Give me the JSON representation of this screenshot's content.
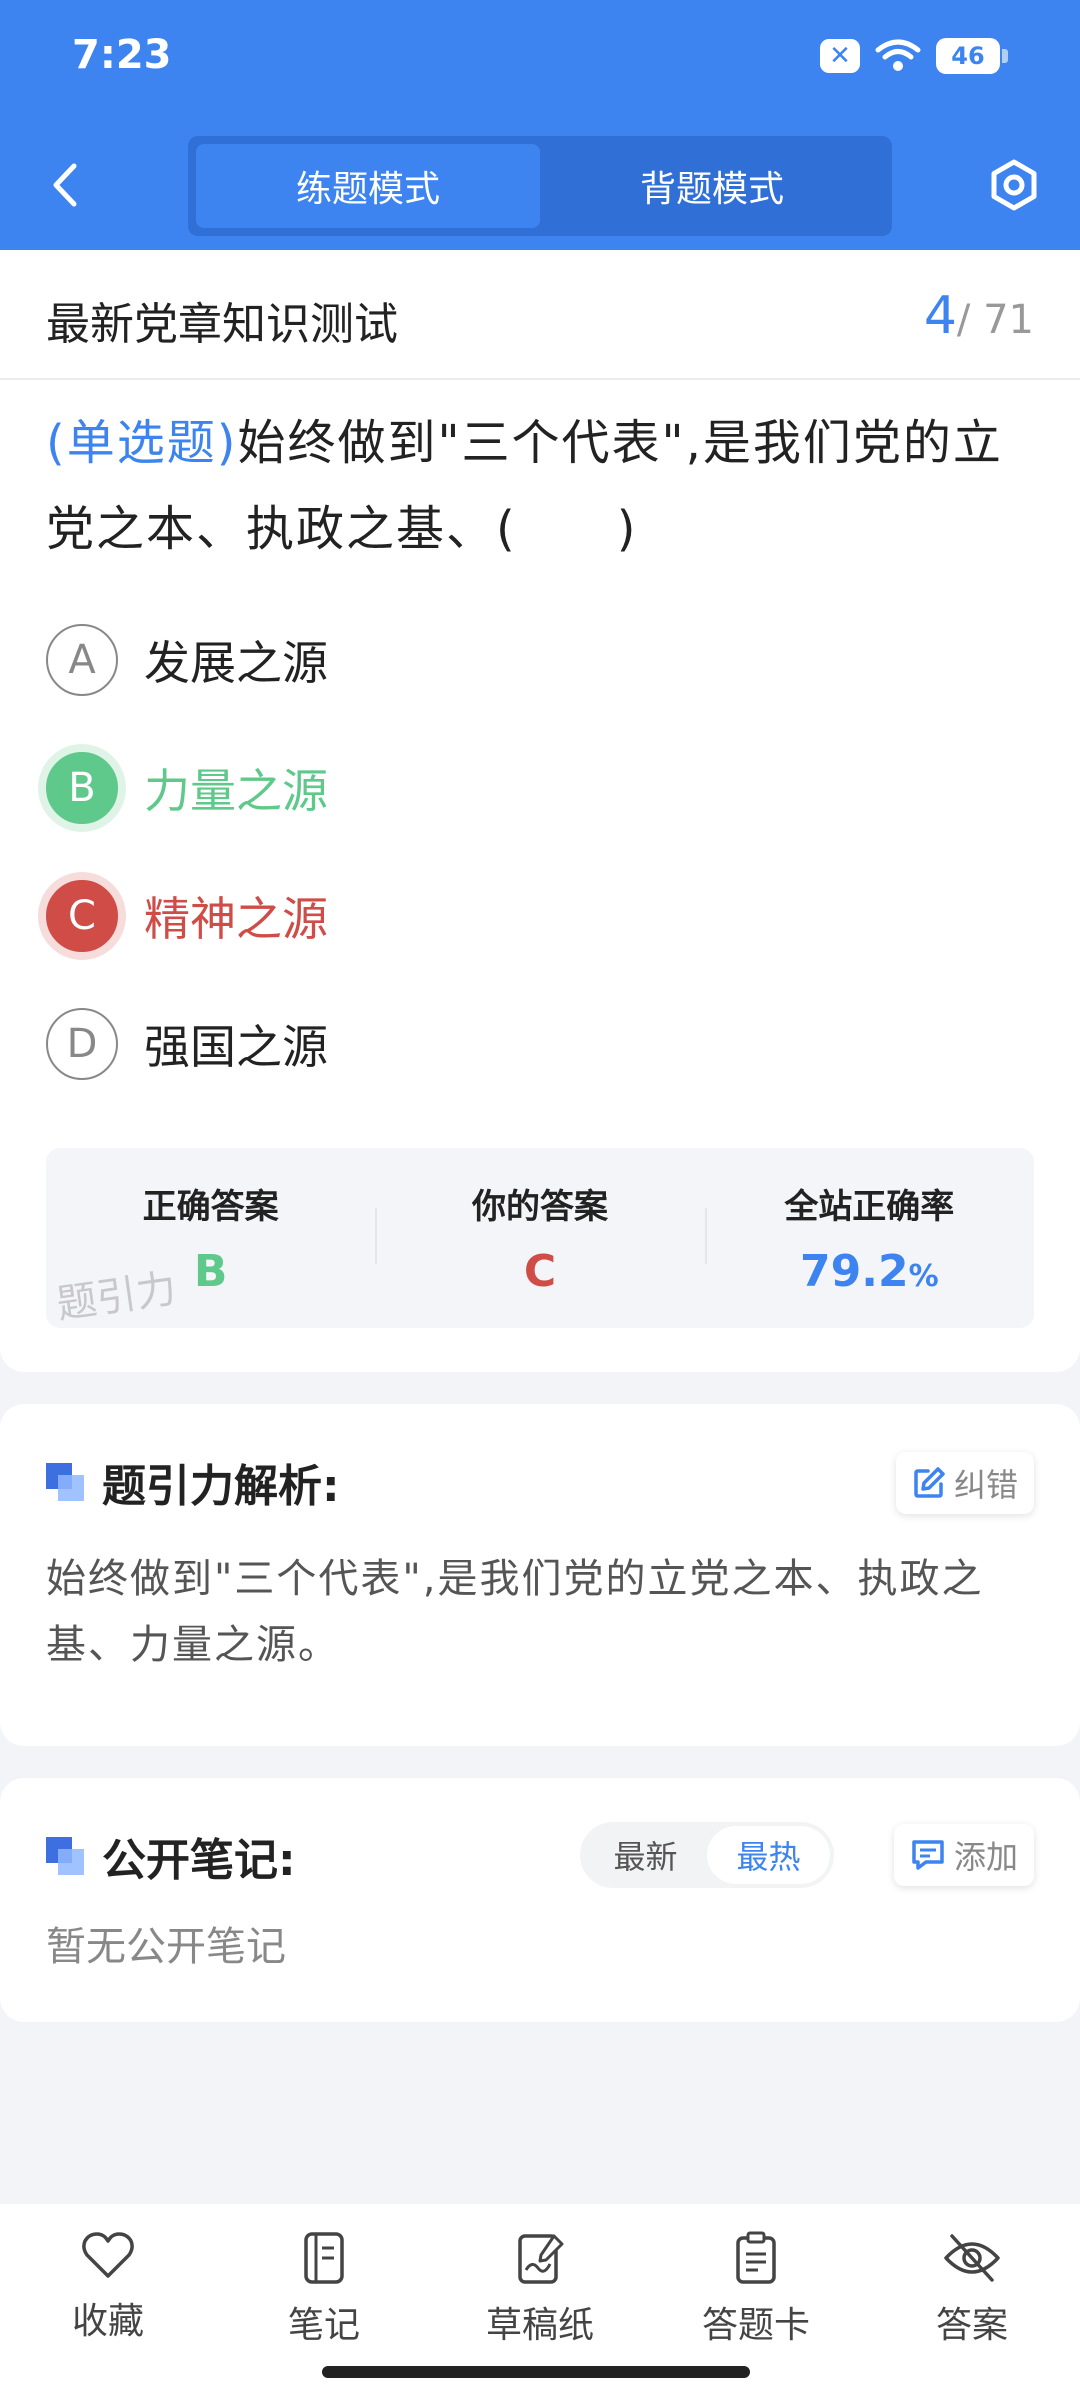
{
  "status": {
    "time": "7:23",
    "battery": "46",
    "sim_icon": "x-icon"
  },
  "header": {
    "back_icon": "chevron-left-icon",
    "tabs": [
      {
        "label": "练题模式",
        "active": true
      },
      {
        "label": "背题模式",
        "active": false
      }
    ],
    "settings_icon": "gear-icon"
  },
  "exam": {
    "title": "最新党章知识测试",
    "current": "4",
    "total": "/ 71"
  },
  "question": {
    "type": "(单选题)",
    "text": "始终做到\"三个代表\",是我们党的立党之本、执政之基、(　　)"
  },
  "options": [
    {
      "letter": "A",
      "text": "发展之源",
      "state": "normal"
    },
    {
      "letter": "B",
      "text": "力量之源",
      "state": "correct"
    },
    {
      "letter": "C",
      "text": "精神之源",
      "state": "wrong"
    },
    {
      "letter": "D",
      "text": "强国之源",
      "state": "normal"
    }
  ],
  "answers": {
    "correct_label": "正确答案",
    "correct_value": "B",
    "yours_label": "你的答案",
    "yours_value": "C",
    "rate_label": "全站正确率",
    "rate_value": "79.2",
    "rate_unit": "%",
    "watermark": "题引力"
  },
  "analysis": {
    "title": "题引力解析:",
    "report_label": "纠错",
    "text": "始终做到\"三个代表\",是我们党的立党之本、执政之基、力量之源。"
  },
  "notes": {
    "title": "公开笔记:",
    "sort_options": [
      {
        "label": "最新",
        "active": false
      },
      {
        "label": "最热",
        "active": true
      }
    ],
    "add_label": "添加",
    "empty_text": "暂无公开笔记"
  },
  "bottom_nav": [
    {
      "label": "收藏",
      "icon": "heart-icon"
    },
    {
      "label": "笔记",
      "icon": "notebook-icon"
    },
    {
      "label": "草稿纸",
      "icon": "draft-icon"
    },
    {
      "label": "答题卡",
      "icon": "answer-card-icon"
    },
    {
      "label": "答案",
      "icon": "eye-off-icon"
    }
  ],
  "colors": {
    "primary": "#3d84f0",
    "correct": "#5ec98a",
    "wrong": "#cf4c47"
  }
}
